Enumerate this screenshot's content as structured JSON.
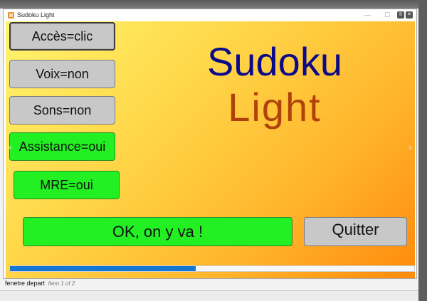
{
  "window": {
    "title": "Sudoku Light",
    "minimize_glyph": "—",
    "maximize_glyph": "☐",
    "close_glyph": "✕",
    "pause_glyph": "II",
    "extra_close_glyph": "✕"
  },
  "heading": {
    "line1": "Sudoku",
    "line2": "Light"
  },
  "buttons": {
    "acces": "Accès=clic",
    "voix": "Voix=non",
    "sons": "Sons=non",
    "assistance": "Assistance=oui",
    "mre": "MRE=oui",
    "ok": "OK, on y va !",
    "quitter": "Quitter"
  },
  "nav": {
    "prev_glyph": "‹",
    "next_glyph": "›"
  },
  "progress": {
    "fraction": 0.46
  },
  "status": {
    "label": "fenetre depart",
    "item": "Item 1 of 2"
  },
  "colors": {
    "green_button": "#22f022",
    "gray_button": "#c8c8c8",
    "heading_blue": "#0a0a8a",
    "heading_orange": "#b04108",
    "progress_blue": "#1477d4"
  }
}
